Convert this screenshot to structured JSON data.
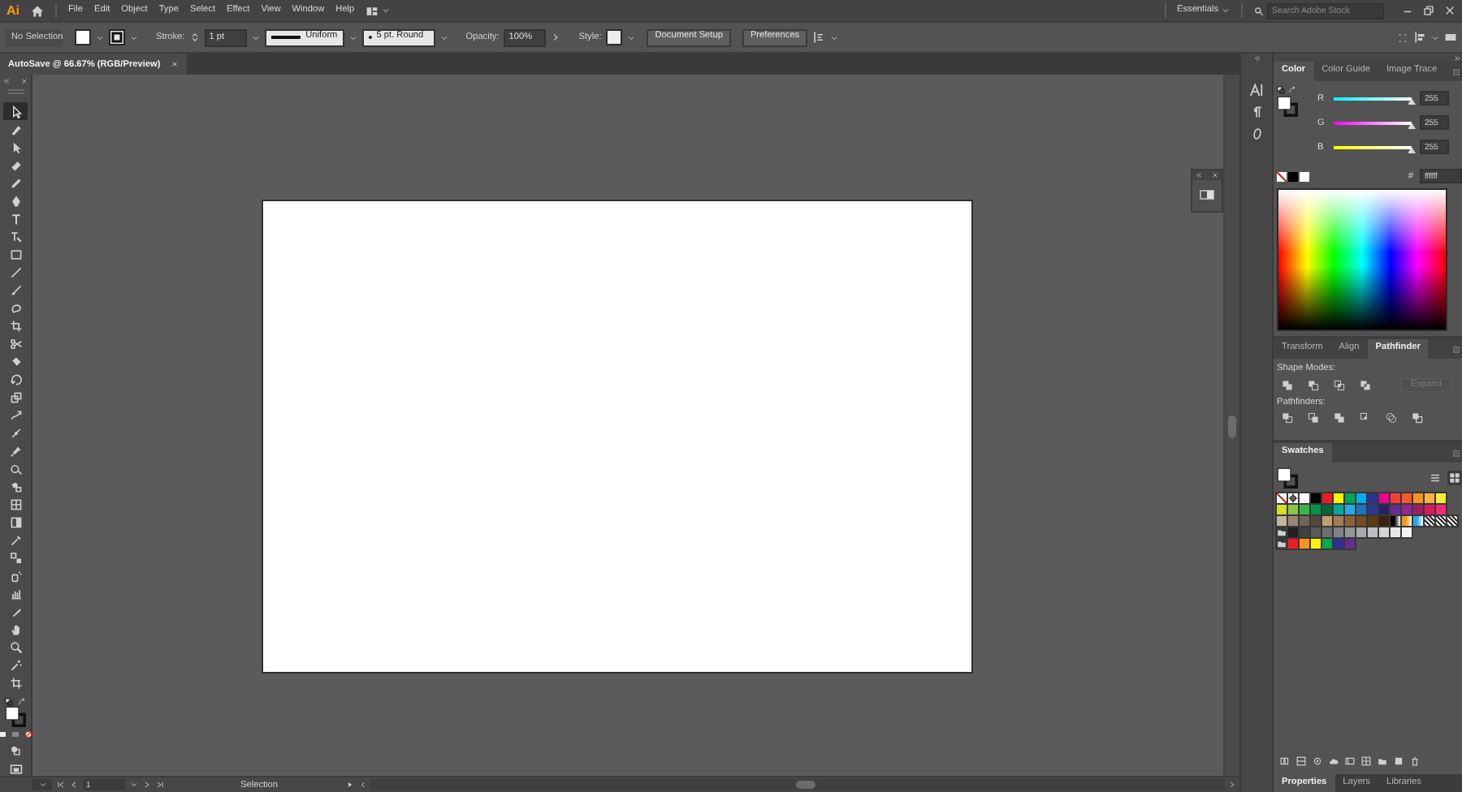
{
  "menubar": {
    "logo": "Ai",
    "menu": [
      "File",
      "Edit",
      "Object",
      "Type",
      "Select",
      "Effect",
      "View",
      "Window",
      "Help"
    ],
    "workspace": "Essentials",
    "search": {
      "placeholder": "Search Adobe Stock"
    }
  },
  "control_bar": {
    "selection": "No Selection",
    "stroke_label": "Stroke:",
    "stroke_weight": "1 pt",
    "stroke_profile": "Uniform",
    "brush": "5 pt. Round",
    "opacity_label": "Opacity:",
    "opacity": "100%",
    "style_label": "Style:",
    "buttons": [
      "Document Setup",
      "Preferences"
    ]
  },
  "document_tabs": [
    {
      "label": "AutoSave @ 66.67% (RGB/Preview)",
      "selected": true
    }
  ],
  "tools": [
    {
      "kind": "arrow",
      "selected": true
    },
    {
      "kind": "curvepen",
      "selected": false
    },
    {
      "kind": "directarrow",
      "selected": false
    },
    {
      "kind": "eraser",
      "selected": false
    },
    {
      "kind": "pencil",
      "selected": false
    },
    {
      "kind": "pen",
      "selected": false
    },
    {
      "kind": "type",
      "selected": false
    },
    {
      "kind": "touchtype",
      "selected": false
    },
    {
      "kind": "rectangle",
      "selected": false
    },
    {
      "kind": "line",
      "selected": false
    },
    {
      "kind": "brush",
      "selected": false
    },
    {
      "kind": "shaper",
      "selected": false
    },
    {
      "kind": "crop",
      "selected": false
    },
    {
      "kind": "scissors",
      "selected": false
    },
    {
      "kind": "puppet",
      "selected": false
    },
    {
      "kind": "rotate",
      "selected": false
    },
    {
      "kind": "scale",
      "selected": false
    },
    {
      "kind": "warp",
      "selected": false
    },
    {
      "kind": "width",
      "selected": false
    },
    {
      "kind": "pin",
      "selected": false
    },
    {
      "kind": "shapebuilder",
      "selected": false
    },
    {
      "kind": "livepaint",
      "selected": false
    },
    {
      "kind": "mesh",
      "selected": false
    },
    {
      "kind": "gradient",
      "selected": false
    },
    {
      "kind": "eyedropper",
      "selected": false
    },
    {
      "kind": "blend",
      "selected": false
    },
    {
      "kind": "spray",
      "selected": false
    },
    {
      "kind": "chart",
      "selected": false
    },
    {
      "kind": "slice",
      "selected": false
    },
    {
      "kind": "hand",
      "selected": false
    },
    {
      "kind": "zoom",
      "selected": false
    },
    {
      "kind": "wand",
      "selected": false
    },
    {
      "kind": "artboard",
      "selected": false
    }
  ],
  "status_bar": {
    "page": "1",
    "tool": "Selection"
  },
  "color_panel": {
    "tabs": [
      {
        "label": "Color",
        "selected": true
      },
      {
        "label": "Color Guide",
        "selected": false
      },
      {
        "label": "Image Trace",
        "selected": false
      }
    ],
    "channels": [
      {
        "name": "R",
        "level": 1,
        "reading": "255"
      },
      {
        "name": "G",
        "level": 1,
        "reading": "255"
      },
      {
        "name": "B",
        "level": 1,
        "reading": "255"
      }
    ],
    "hex_label": "#",
    "hex": "ffffff"
  },
  "pathfinder_panel": {
    "tabs": [
      {
        "label": "Transform",
        "selected": false
      },
      {
        "label": "Align",
        "selected": false
      },
      {
        "label": "Pathfinder",
        "selected": true
      }
    ],
    "shape_modes_label": "Shape Modes:",
    "expand_button": {
      "label": "Expand",
      "disabled": true
    },
    "pathfinders_label": "Pathfinders:"
  },
  "swatches_panel": {
    "tabs": [
      {
        "label": "Swatches",
        "selected": true
      }
    ],
    "view_modes": [
      {
        "kind": "list",
        "selected": false
      },
      {
        "kind": "grid",
        "selected": true
      }
    ],
    "rows": [
      {
        "items": [
          {
            "kind": "none"
          },
          {
            "kind": "registration"
          },
          {
            "kind": "color",
            "color": "#ffffff"
          },
          {
            "kind": "color",
            "color": "#000000"
          },
          {
            "kind": "color",
            "color": "#ed1c24"
          },
          {
            "kind": "color",
            "color": "#fff200"
          },
          {
            "kind": "color",
            "color": "#00a651"
          },
          {
            "kind": "color",
            "color": "#00aeef"
          },
          {
            "kind": "color",
            "color": "#2e3192"
          },
          {
            "kind": "color",
            "color": "#ec008c"
          },
          {
            "kind": "color",
            "color": "#ef4136"
          },
          {
            "kind": "color",
            "color": "#f15a29"
          },
          {
            "kind": "color",
            "color": "#f7941d"
          },
          {
            "kind": "color",
            "color": "#fbb040"
          },
          {
            "kind": "color",
            "color": "#f9ed32"
          }
        ]
      },
      {
        "items": [
          {
            "kind": "color",
            "color": "#d7df23"
          },
          {
            "kind": "color",
            "color": "#8dc63f"
          },
          {
            "kind": "color",
            "color": "#39b54a"
          },
          {
            "kind": "color",
            "color": "#009444"
          },
          {
            "kind": "color",
            "color": "#006838"
          },
          {
            "kind": "color",
            "color": "#00a79d"
          },
          {
            "kind": "color",
            "color": "#27aae1"
          },
          {
            "kind": "color",
            "color": "#1c75bc"
          },
          {
            "kind": "color",
            "color": "#2b3990"
          },
          {
            "kind": "color",
            "color": "#262262"
          },
          {
            "kind": "color",
            "color": "#662d91"
          },
          {
            "kind": "color",
            "color": "#92278f"
          },
          {
            "kind": "color",
            "color": "#9e1f63"
          },
          {
            "kind": "color",
            "color": "#da1c5c"
          },
          {
            "kind": "color",
            "color": "#ee2a7b"
          }
        ]
      },
      {
        "items": [
          {
            "kind": "color",
            "color": "#c2b59b"
          },
          {
            "kind": "color",
            "color": "#998675"
          },
          {
            "kind": "color",
            "color": "#736357"
          },
          {
            "kind": "color",
            "color": "#534741"
          },
          {
            "kind": "color",
            "color": "#c69c6d"
          },
          {
            "kind": "color",
            "color": "#a67c52"
          },
          {
            "kind": "color",
            "color": "#8c6239"
          },
          {
            "kind": "color",
            "color": "#754c24"
          },
          {
            "kind": "color",
            "color": "#603913"
          },
          {
            "kind": "color",
            "color": "#42210b"
          },
          {
            "kind": "gradient",
            "color": "#000000"
          },
          {
            "kind": "gradient",
            "color": "#f7941d"
          },
          {
            "kind": "gradient",
            "color": "#29abe2"
          },
          {
            "kind": "pattern"
          },
          {
            "kind": "pattern"
          },
          {
            "kind": "pattern"
          }
        ]
      },
      {
        "items": [
          {
            "kind": "folder"
          },
          {
            "kind": "color",
            "color": "#231f20"
          },
          {
            "kind": "color",
            "color": "#414042"
          },
          {
            "kind": "color",
            "color": "#58595b"
          },
          {
            "kind": "color",
            "color": "#6d6e71"
          },
          {
            "kind": "color",
            "color": "#808285"
          },
          {
            "kind": "color",
            "color": "#939598"
          },
          {
            "kind": "color",
            "color": "#a7a9ac"
          },
          {
            "kind": "color",
            "color": "#bcbec0"
          },
          {
            "kind": "color",
            "color": "#d1d3d4"
          },
          {
            "kind": "color",
            "color": "#e6e7e8"
          },
          {
            "kind": "color",
            "color": "#f1f2f2"
          }
        ]
      },
      {
        "items": [
          {
            "kind": "folder"
          },
          {
            "kind": "color",
            "color": "#ed1c24"
          },
          {
            "kind": "color",
            "color": "#f7941d"
          },
          {
            "kind": "color",
            "color": "#fff200"
          },
          {
            "kind": "color",
            "color": "#00a651"
          },
          {
            "kind": "color",
            "color": "#2e3192"
          },
          {
            "kind": "color",
            "color": "#662d91"
          }
        ]
      }
    ]
  },
  "bottom_tabs": [
    {
      "label": "Properties",
      "selected": true
    },
    {
      "label": "Layers",
      "selected": false
    },
    {
      "label": "Libraries",
      "selected": false
    }
  ]
}
